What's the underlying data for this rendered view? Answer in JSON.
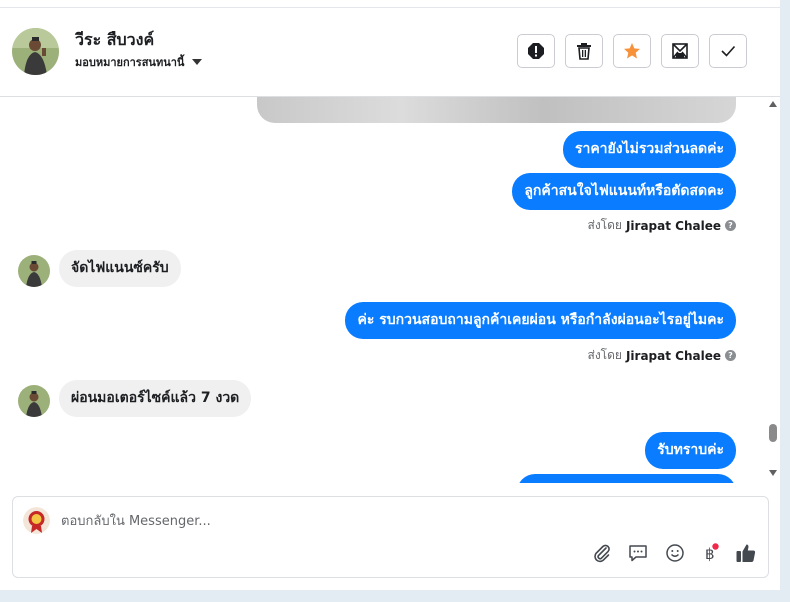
{
  "header": {
    "contact_name": "วีระ สืบวงค์",
    "assign_label": "มอบหมายการสนทนานี้",
    "actions": [
      "spam-icon",
      "trash-icon",
      "star-icon",
      "mark-unread-icon",
      "done-icon"
    ],
    "star_color": "#f7923b"
  },
  "messages": [
    {
      "direction": "outgoing",
      "text": "ราคายังไม่รวมส่วนลดค่ะ"
    },
    {
      "direction": "outgoing",
      "text": "ลูกค้าสนใจไฟแนนท์หรือตัดสดคะ"
    },
    {
      "direction": "sent_by",
      "prefix": "ส่งโดย",
      "name": "Jirapat Chalee"
    },
    {
      "direction": "incoming",
      "text": "จัดไฟแนนซ์ครับ"
    },
    {
      "direction": "outgoing",
      "text": "ค่ะ รบกวนสอบถามลูกค้าเคยผ่อน หรือกำลังผ่อนอะไรอยู่ไมคะ"
    },
    {
      "direction": "sent_by",
      "prefix": "ส่งโดย",
      "name": "Jirapat Chalee"
    },
    {
      "direction": "incoming",
      "text": "ผ่อนมอเตอร์ไซค์แล้ว 7 งวด"
    },
    {
      "direction": "outgoing",
      "text": "รับทราบค่ะ"
    }
  ],
  "composer": {
    "placeholder": "ตอบกลับใน Messenger...",
    "tools": [
      "attach-icon",
      "saved-reply-icon",
      "emoji-icon",
      "payment-icon",
      "like-icon"
    ]
  },
  "colors": {
    "outgoing_bubble": "#0a7cff",
    "incoming_bubble": "#f0f0f0",
    "notification_dot": "#f02849"
  }
}
